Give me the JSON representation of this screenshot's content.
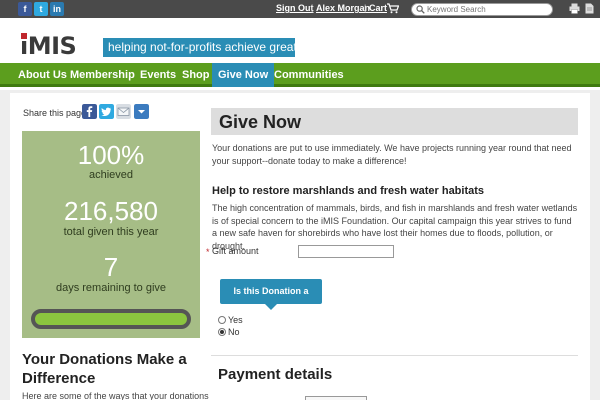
{
  "topbar": {
    "social": [
      {
        "name": "facebook",
        "glyph": "f",
        "color": "#3b5998"
      },
      {
        "name": "twitter",
        "glyph": "t",
        "color": "#2fa9e0"
      },
      {
        "name": "linkedin",
        "glyph": "in",
        "color": "#2a7ab0"
      }
    ],
    "sign_out": "Sign Out",
    "user": "Alex Morgan",
    "cart": "Cart",
    "search_placeholder": "Keyword Search"
  },
  "header": {
    "logo": "iMIS",
    "tagline": "helping not-for-profits achieve great things"
  },
  "nav": {
    "items": [
      "About Us",
      "Membership",
      "Events",
      "Shop",
      "Give Now",
      "Communities"
    ],
    "active": "Give Now"
  },
  "sidebar": {
    "share_label": "Share this page",
    "stats": {
      "percent": "100%",
      "percent_label": "achieved",
      "total": "216,580",
      "total_label": "total given this year",
      "days": "7",
      "days_label": "days remaining to give",
      "progress": 1.0
    },
    "donations_title": "Your Donations Make a Difference",
    "donations_text": "Here are some of the ways that your donations"
  },
  "main": {
    "title": "Give Now",
    "intro": "Your donations are put to use immediately. We have projects running year round that need your support--donate today to make a difference!",
    "sub_heading": "Help to restore marshlands and fresh water habitats",
    "paragraph": "The high concentration of mammals, birds, and fish in marshlands and fresh water wetlands is of special concern to the iMIS Foundation. Our capital campaign this year strives to fund a new safe haven for shorebirds who have lost their homes due to floods, pollution, or drought.",
    "gift_label": "Gift amount",
    "gift_value": "",
    "tribute_label": "Is this Donation a tribute?",
    "radio_yes": "Yes",
    "radio_no": "No",
    "payment_heading": "Payment details"
  },
  "colors": {
    "nav_green": "#5c9e1e",
    "accent_blue": "#2a8db5",
    "stats_green": "#a6bd86",
    "progress_green": "#8bc53f"
  }
}
